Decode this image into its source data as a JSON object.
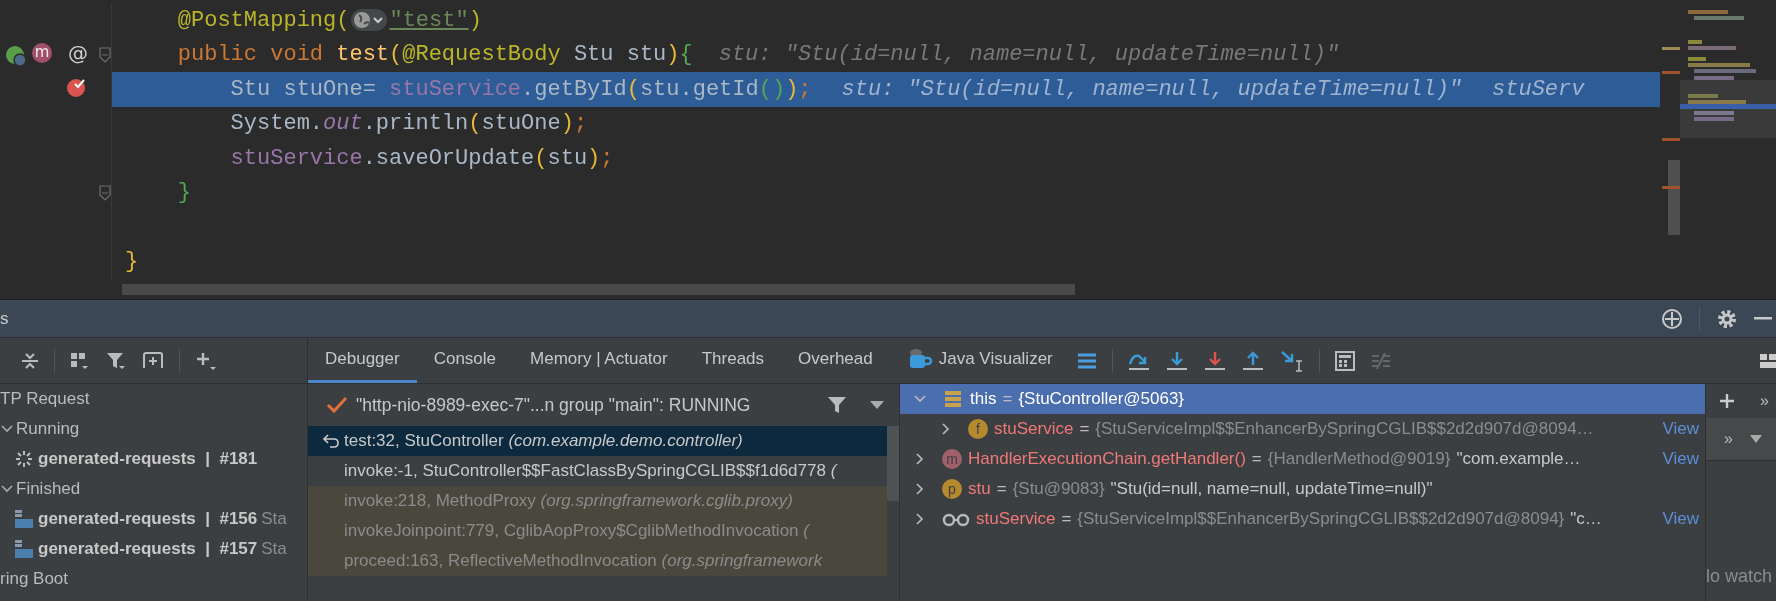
{
  "editor": {
    "lines": [
      {
        "breakpoint": false,
        "highlighted": false,
        "tokens": [
          {
            "kind": "annotation",
            "text": "    @PostMapping("
          },
          {
            "kind": "inlay-icon"
          },
          {
            "kind": "string",
            "text": "\"test\""
          },
          {
            "kind": "annotation",
            "text": ")"
          }
        ]
      },
      {
        "breakpoint": false,
        "highlighted": false,
        "fold": true,
        "gutter": [
          {
            "kind": "endpoint"
          },
          {
            "kind": "bean",
            "letter": "m"
          },
          {
            "kind": "at",
            "letter": "@"
          }
        ],
        "tokens": [
          {
            "kind": "keyword",
            "text": "    public void "
          },
          {
            "kind": "method",
            "text": "test"
          },
          {
            "kind": "paren",
            "text": "("
          },
          {
            "kind": "annotation",
            "text": "@RequestBody"
          },
          {
            "kind": "plain",
            "text": " Stu stu"
          },
          {
            "kind": "paren",
            "text": ")"
          },
          {
            "kind": "brace",
            "text": "{"
          }
        ],
        "hints": [
          "stu: \"Stu(id=null, name=null, updateTime=null)\""
        ]
      },
      {
        "breakpoint": true,
        "highlighted": true,
        "tokens": [
          {
            "kind": "plain",
            "text": "        Stu stuOne= "
          },
          {
            "kind": "field",
            "text": "stuService"
          },
          {
            "kind": "plain",
            "text": ".getById"
          },
          {
            "kind": "paren",
            "text": "("
          },
          {
            "kind": "plain",
            "text": "stu.getId"
          },
          {
            "kind": "brace",
            "text": "()"
          },
          {
            "kind": "paren",
            "text": ")"
          },
          {
            "kind": "semicolon",
            "text": ";"
          }
        ],
        "hints": [
          "stu: \"Stu(id=null, name=null, updateTime=null)\"",
          "stuServ"
        ]
      },
      {
        "breakpoint": false,
        "highlighted": false,
        "tokens": [
          {
            "kind": "plain",
            "text": "        System."
          },
          {
            "kind": "static-field",
            "text": "out"
          },
          {
            "kind": "plain",
            "text": ".println"
          },
          {
            "kind": "paren",
            "text": "("
          },
          {
            "kind": "plain",
            "text": "stuOne"
          },
          {
            "kind": "paren",
            "text": ")"
          },
          {
            "kind": "semicolon",
            "text": ";"
          }
        ]
      },
      {
        "breakpoint": false,
        "highlighted": false,
        "tokens": [
          {
            "kind": "field",
            "text": "        stuService"
          },
          {
            "kind": "plain",
            "text": ".saveOrUpdate"
          },
          {
            "kind": "paren",
            "text": "("
          },
          {
            "kind": "plain",
            "text": "stu"
          },
          {
            "kind": "paren",
            "text": ")"
          },
          {
            "kind": "semicolon",
            "text": ";"
          }
        ]
      },
      {
        "breakpoint": false,
        "highlighted": false,
        "fold": true,
        "tokens": [
          {
            "kind": "brace",
            "text": "    }"
          }
        ]
      },
      {
        "breakpoint": false,
        "highlighted": false
      },
      {
        "breakpoint": false,
        "highlighted": false,
        "tokens": [
          {
            "kind": "paren",
            "text": "}"
          }
        ]
      }
    ]
  },
  "panel": {
    "title": "s",
    "tree": [
      {
        "label": "TP Request",
        "children": [
          {
            "label": "Running",
            "expanded": true,
            "children": [
              {
                "kind": "running",
                "label": "generated-requests  |  #181"
              }
            ]
          },
          {
            "label": "Finished",
            "expanded": true,
            "children": [
              {
                "kind": "api",
                "label": "generated-requests  |  #156",
                "status": "Sta"
              },
              {
                "kind": "api",
                "label": "generated-requests  |  #157",
                "status": "Sta"
              }
            ]
          }
        ]
      },
      {
        "label": "ring Boot"
      }
    ],
    "tabs": [
      {
        "label": "Debugger",
        "selected": true
      },
      {
        "label": "Console",
        "selected": false
      },
      {
        "label": "Memory | Actuator",
        "selected": false
      },
      {
        "label": "Threads",
        "selected": false
      },
      {
        "label": "Overhead",
        "selected": false
      },
      {
        "label": "Java Visualizer",
        "selected": false,
        "kind": "visualizer"
      }
    ],
    "thread": "\"http-nio-8989-exec-7\"...n group \"main\": RUNNING",
    "frames": [
      {
        "method": "test:32, StuController",
        "location": "(com.example.demo.controller)",
        "selected": true,
        "library": false
      },
      {
        "method": "invoke:-1, StuController$$FastClassBySpringCGLIB$$f1d6d778",
        "location": "(",
        "selected": false,
        "library": false
      },
      {
        "method": "invoke:218, MethodProxy",
        "location": "(org.springframework.cglib.proxy)",
        "selected": false,
        "library": true
      },
      {
        "method": "invokeJoinpoint:779, CglibAopProxy$CglibMethodInvocation",
        "location": "(",
        "selected": false,
        "library": true
      },
      {
        "method": "proceed:163, ReflectiveMethodInvocation",
        "location": "(org.springframework",
        "selected": false,
        "library": true
      }
    ],
    "variables": [
      {
        "kind": "object",
        "name": "this",
        "sep": "=",
        "value": "{StuController@5063}",
        "selected": true,
        "expanded": true,
        "children": [
          {
            "kind": "field",
            "icon_letter": "f",
            "name": "stuService",
            "sep": "=",
            "value": "{StuServiceImpl$$EnhancerBySpringCGLIB$$2d2d907d@8094…",
            "link": "View",
            "selected": false,
            "expanded": false
          }
        ]
      },
      {
        "kind": "method",
        "icon_letter": "m",
        "name": "HandlerExecutionChain.getHandler()",
        "sep": "=",
        "value": "{HandlerMethod@9019}",
        "text": "\"com.example…",
        "link": "View",
        "selected": false,
        "expanded": false
      },
      {
        "kind": "parameter",
        "icon_letter": "p",
        "name": "stu",
        "sep": "=",
        "value": "{Stu@9083}",
        "text": "\"Stu(id=null, name=null, updateTime=null)\"",
        "selected": false,
        "expanded": false
      },
      {
        "kind": "watch",
        "name": "stuService",
        "sep": "=",
        "value": "{StuServiceImpl$$EnhancerBySpringCGLIB$$2d2d907d@8094}",
        "text": "\"c…",
        "link": "View",
        "selected": false,
        "expanded": false
      }
    ],
    "watches": {
      "more": "»",
      "more_tabs": "»",
      "empty": "lo watch"
    }
  }
}
